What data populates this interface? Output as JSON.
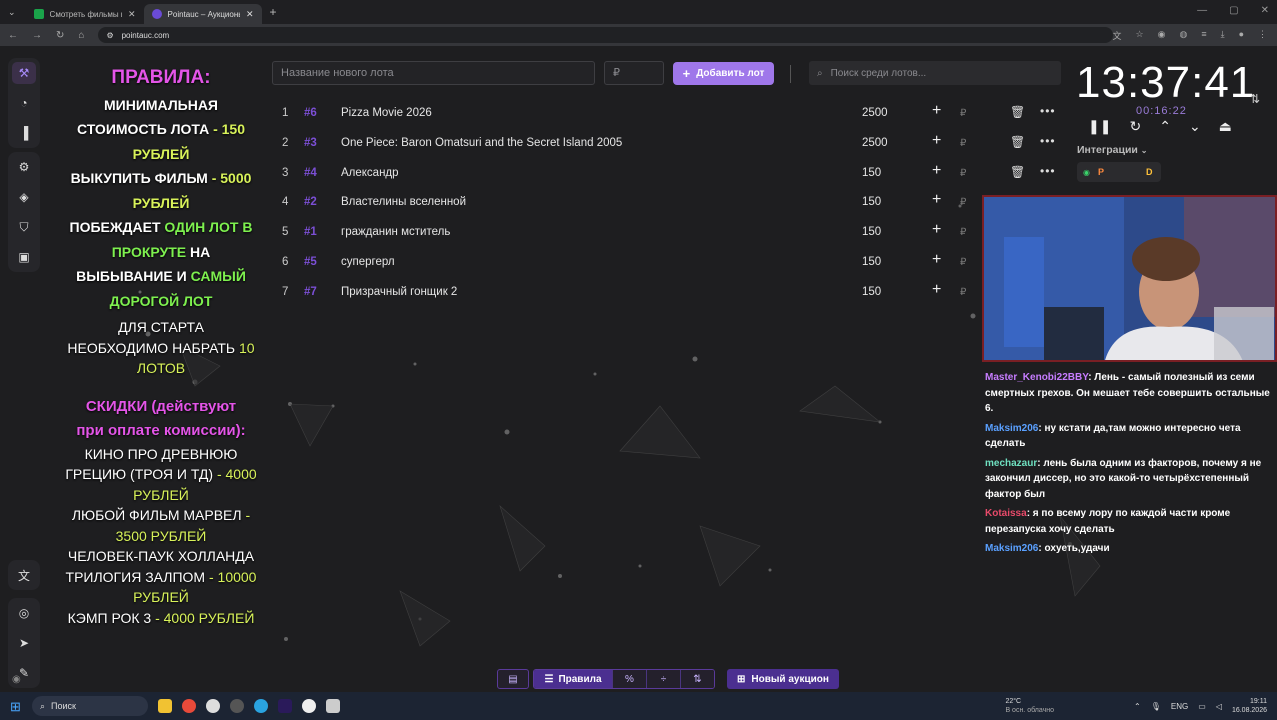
{
  "browser": {
    "tabs": [
      {
        "label": "Смотреть фильмы и сериалы"
      },
      {
        "label": "Pointauc – Аукционы, лотере"
      }
    ],
    "url": "pointauc.com"
  },
  "rules": {
    "title": "ПРАВИЛА:",
    "l1": "МИНИМАЛЬНАЯ",
    "l2a": "СТОИМОСТЬ ЛОТА",
    "l2b": " - 150",
    "l3": "РУБЛЕЙ",
    "l4a": "ВЫКУПИТЬ ФИЛЬМ",
    "l4b": " - 5000",
    "l5": "РУБЛЕЙ",
    "l6a": "ПОБЕЖДАЕТ ",
    "l6b": "ОДИН ЛОТ В",
    "l7a": "ПРОКРУТЕ",
    "l7b": " НА",
    "l8a": "ВЫБЫВАНИЕ И ",
    "l8b": "САМЫЙ",
    "l9": "ДОРОГОЙ ЛОТ",
    "l10": "ДЛЯ СТАРТА",
    "l11a": "НЕОБХОДИМО НАБРАТЬ ",
    "l11b": "10",
    "l12": "ЛОТОВ",
    "discount_title_1": "СКИДКИ (действуют",
    "discount_title_2": "при оплате комиссии):",
    "d1": "КИНО ПРО ДРЕВНЮЮ",
    "d2a": "ГРЕЦИЮ (ТРОЯ И ТД)",
    "d2b": " - 4000",
    "d3": "РУБЛЕЙ",
    "d4a": "ЛЮБОЙ ФИЛЬМ МАРВЕЛ",
    "d4b": " -",
    "d5": "3500 РУБЛЕЙ",
    "d6": "ЧЕЛОВЕК-ПАУК ХОЛЛАНДА",
    "d7a": "ТРИЛОГИЯ ЗАЛПОМ",
    "d7b": " - 10000",
    "d8": "РУБЛЕЙ",
    "d9a": "КЭМП РОК 3",
    "d9b": " - 4000 РУБЛЕЙ"
  },
  "controls": {
    "new_lot_placeholder": "Название нового лота",
    "amount_placeholder": "₽",
    "add_label": "Добавить лот",
    "search_placeholder": "Поиск среди лотов..."
  },
  "lots": [
    {
      "num": "1",
      "hash": "#6",
      "name": "Pizza Movie 2026",
      "amount": "2500",
      "trash": true
    },
    {
      "num": "2",
      "hash": "#3",
      "name": "One Piece: Baron Omatsuri and the Secret Island 2005",
      "amount": "2500",
      "trash": true
    },
    {
      "num": "3",
      "hash": "#4",
      "name": "Александр",
      "amount": "150",
      "trash": true
    },
    {
      "num": "4",
      "hash": "#2",
      "name": "Властелины вселенной",
      "amount": "150",
      "trash": false
    },
    {
      "num": "5",
      "hash": "#1",
      "name": "гражданин мститель",
      "amount": "150",
      "trash": false
    },
    {
      "num": "6",
      "hash": "#5",
      "name": "супергерл",
      "amount": "150",
      "trash": false
    },
    {
      "num": "7",
      "hash": "#7",
      "name": "Призрачный гонщик 2",
      "amount": "150",
      "trash": false
    }
  ],
  "lot_ruble": "₽",
  "timer": {
    "main": "13:37:41",
    "sub": "00:16:22"
  },
  "integrations": {
    "label": "Интеграции",
    "p": "P",
    "d": "D"
  },
  "chat": [
    {
      "user": "Master_Kenobi22BBY",
      "color": "#c77dff",
      "text": ": Лень - самый полезный из семи смертных грехов. Он мешает тебе совершить остальные 6."
    },
    {
      "user": "Maksim206",
      "color": "#5aa0ff",
      "text": ": ну кстати да,там можно интересно чета сделать"
    },
    {
      "user": "mechazaur",
      "color": "#6fe0c0",
      "text": ": лень была одним из факторов, почему я не закончил диссер, но это какой-то четырёхстепенный фактор был"
    },
    {
      "user": "Kotaissa",
      "color": "#e84a6a",
      "text": ": я по всему лору по каждой части кроме перезапуска хочу сделать"
    },
    {
      "user": "Maksim206",
      "color": "#5aa0ff",
      "text": ": охуеть,удачи"
    }
  ],
  "bottom": {
    "rules_label": "Правила",
    "new_auction": "Новый аукцион"
  },
  "taskbar": {
    "search": "Поиск",
    "temp": "22°C",
    "weather": "В осн. облачно",
    "lang": "ENG",
    "time": "19:11",
    "date": "16.08.2026"
  }
}
